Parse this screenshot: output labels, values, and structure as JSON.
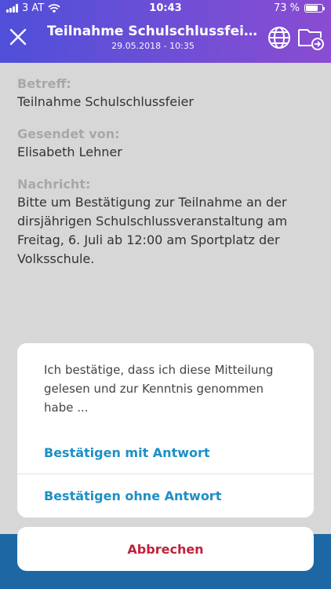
{
  "status_bar": {
    "carrier": "3 AT",
    "time": "10:43",
    "battery_text": "73 %",
    "battery_level": 0.73
  },
  "nav": {
    "title": "Teilnahme Schulschlussfeier",
    "subtitle": "29.05.2018 - 10:35",
    "close_icon": "close-icon",
    "globe_icon": "globe-icon",
    "folder_icon": "folder-move-icon"
  },
  "message": {
    "subject_label": "Betreff:",
    "subject": "Teilnahme Schulschlussfeier",
    "sender_label": "Gesendet von:",
    "sender": "Elisabeth Lehner",
    "body_label": "Nachricht:",
    "body": "Bitte um Bestätigung zur Teilnahme an der dirsjährigen Schulschlussveranstaltung am Freitag, 6. Juli ab 12:00 am Sportplatz der Volksschule."
  },
  "dialog": {
    "message": "Ich bestätige, dass ich diese Mitteilung gelesen und zur Kenntnis genommen habe ...",
    "confirm_with_reply": "Bestätigen mit Antwort",
    "confirm_without_reply": "Bestätigen ohne Antwort",
    "cancel": "Abbrechen"
  },
  "colors": {
    "header_start": "#4f4fd9",
    "header_end": "#8a4cd2",
    "action_blue": "#1d8fc6",
    "cancel_red": "#c0223b"
  }
}
